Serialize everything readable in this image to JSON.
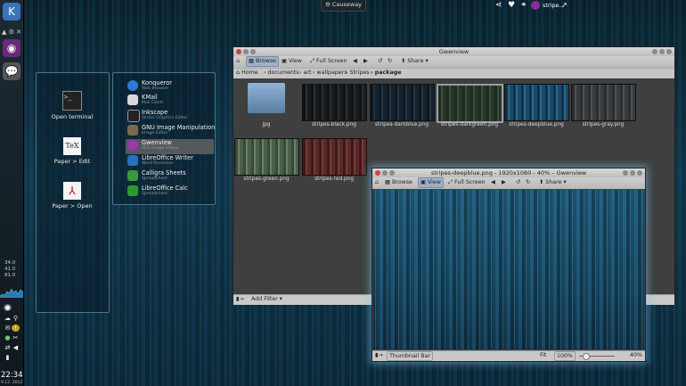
{
  "top_bar": {
    "activity_label": "Causeway",
    "user_label": "stripe..."
  },
  "left_panel": {
    "stats": [
      "34.0",
      "41.0",
      "81.0"
    ],
    "clock_time": "22:34",
    "clock_date": "9.12. 2012"
  },
  "activity": {
    "items": [
      {
        "label": "Open terminal"
      },
      {
        "label": "Paper > Edit"
      },
      {
        "label": "Paper > Open"
      }
    ]
  },
  "launcher": {
    "apps": [
      {
        "name": "Konqueror",
        "desc": "Web Browser",
        "color": "#2b7bd6"
      },
      {
        "name": "KMail",
        "desc": "Mail Client",
        "color": "#d9d9d9"
      },
      {
        "name": "Inkscape",
        "desc": "Vector Graphics Editor",
        "color": "#222222"
      },
      {
        "name": "GNU Image Manipulation",
        "desc": "Image Editor",
        "color": "#7a6a4a"
      },
      {
        "name": "Gwenview",
        "desc": "KDE Image Viewer",
        "color": "#9a3aa8"
      },
      {
        "name": "LibreOffice Writer",
        "desc": "Word Processor",
        "color": "#2a6fc0"
      },
      {
        "name": "Calligra Sheets",
        "desc": "Spreadsheet",
        "color": "#3a9a3a"
      },
      {
        "name": "LibreOffice Calc",
        "desc": "Spreadsheet",
        "color": "#2c9b2c"
      }
    ]
  },
  "gwenview_main": {
    "title": "Gwenview",
    "toolbar": {
      "browse": "Browse",
      "view": "View",
      "fullscreen": "Full Screen",
      "share": "Share"
    },
    "breadcrumb": [
      "Home",
      "documents",
      "art",
      "wallpapers",
      "Stripes",
      "package"
    ],
    "files": [
      {
        "name": "jpg",
        "color": "#6d8fb0"
      },
      {
        "name": "stripes-black.png",
        "color": "#1b1f22"
      },
      {
        "name": "stripes-darkblue.png",
        "color": "#14222e"
      },
      {
        "name": "stripes-darkgreen.png",
        "color": "#2a3a2a"
      },
      {
        "name": "stripes-deepblue.png",
        "color": "#1c4a66"
      },
      {
        "name": "stripes-gray.png",
        "color": "#3c3f42"
      },
      {
        "name": "stripes-green.png",
        "color": "#4a5e4a"
      },
      {
        "name": "stripes-red.png",
        "color": "#5a2a2a"
      }
    ],
    "add_filter": "Add Filter"
  },
  "gwenview_view": {
    "title": "stripes-deepblue.png - 1920x1080 - 40% – Gwenview",
    "toolbar": {
      "browse": "Browse",
      "view": "View",
      "fullscreen": "Full Screen",
      "share": "Share"
    },
    "thumbnail_bar": "Thumbnail Bar",
    "fit": "Fit",
    "zoom_100": "100%",
    "zoom_level": "40%"
  },
  "colors": {
    "accent": "#3a5c8c",
    "image_blue": "#1f5b7a"
  }
}
